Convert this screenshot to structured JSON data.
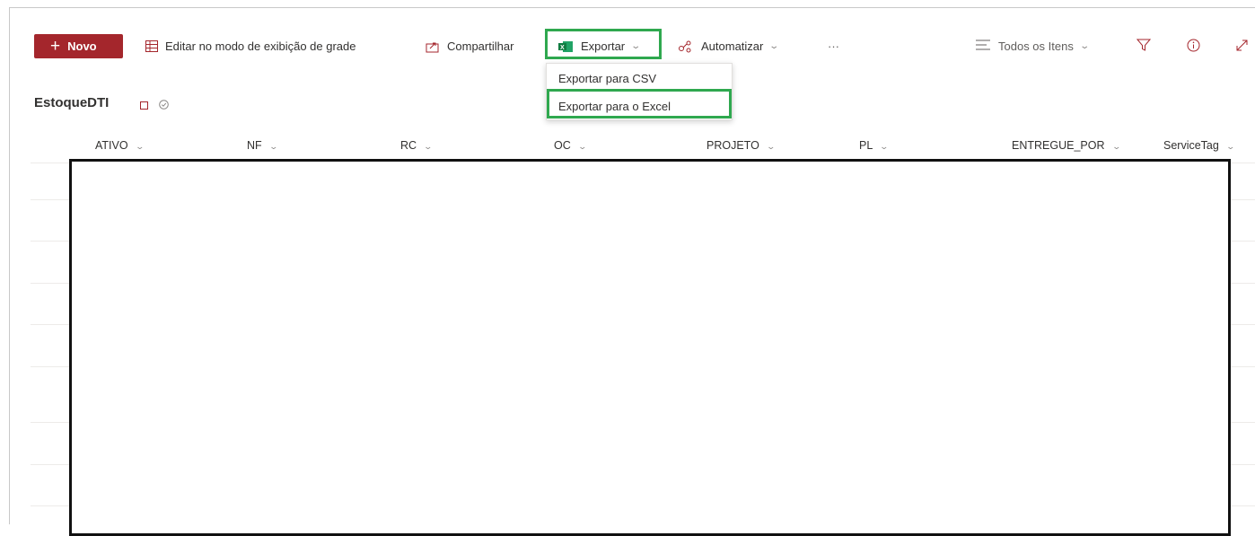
{
  "commandbar": {
    "new_label": "Novo",
    "edit_grid_label": "Editar no modo de exibição de grade",
    "share_label": "Compartilhar",
    "export_label": "Exportar",
    "automate_label": "Automatizar",
    "more_label": "···",
    "view_label": "Todos os Itens"
  },
  "export_menu": {
    "items": [
      "Exportar para CSV",
      "Exportar para o Excel"
    ],
    "highlighted": "Exportar para o Excel"
  },
  "list": {
    "title": "EstoqueDTI"
  },
  "columns": [
    "ATIVO",
    "NF",
    "RC",
    "OC",
    "PROJETO",
    "PL",
    "ENTREGUE_POR",
    "ServiceTag"
  ],
  "colors": {
    "accent": "#a4262c",
    "highlight": "#2fa84f",
    "excel": "#217346"
  }
}
